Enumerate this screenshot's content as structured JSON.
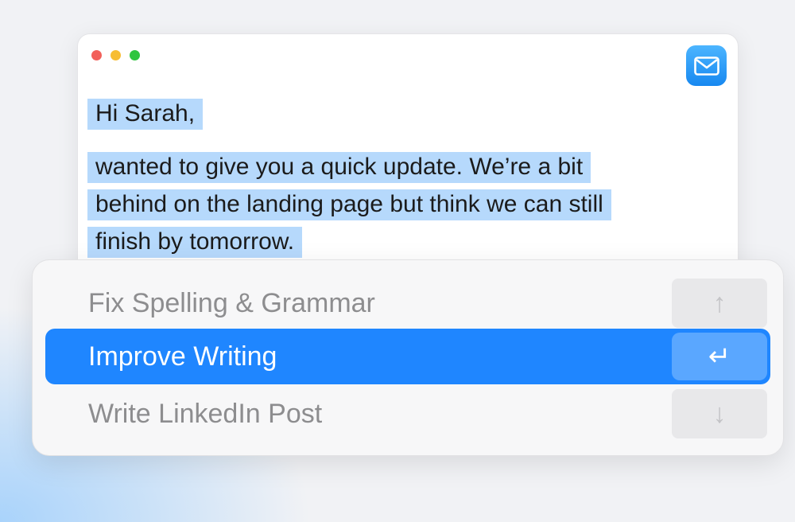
{
  "email_window": {
    "greeting": "Hi Sarah,",
    "body_lines": [
      "wanted to give you a quick update. We’re a bit",
      "behind on the landing page but think we can still",
      "finish by tomorrow."
    ],
    "app_icon": "mail-icon"
  },
  "menu": {
    "items": [
      {
        "label": "Fix Spelling & Grammar",
        "shortcut": "↑",
        "shortcut_icon": "arrow-up-icon",
        "selected": false
      },
      {
        "label": "Improve Writing",
        "shortcut": "↵",
        "shortcut_icon": "return-icon",
        "selected": true
      },
      {
        "label": "Write LinkedIn Post",
        "shortcut": "↓",
        "shortcut_icon": "arrow-down-icon",
        "selected": false
      }
    ]
  },
  "colors": {
    "selection_highlight": "#b6d9fc",
    "selected_item": "#1f86ff",
    "mail_icon": "#1f8ef5"
  }
}
